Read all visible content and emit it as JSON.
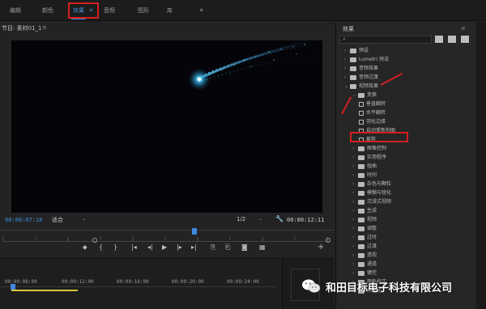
{
  "workspace_tabs": [
    "编辑",
    "颜色",
    "效果",
    "音频",
    "图形",
    "库",
    "»"
  ],
  "workspace_active": "效果",
  "workspace_menu_icon": "≡",
  "program_monitor": {
    "title": "节目: 素材01_1",
    "menu": "≡",
    "timecode_left": "00:00:07:18",
    "fit_label": "适合",
    "resolution_label": "1/2",
    "timecode_right": "00:00:12:11"
  },
  "transport_icons": [
    "marker-icon",
    "in-point-icon",
    "out-point-icon",
    "go-to-in-icon",
    "step-back-icon",
    "play-icon",
    "step-forward-icon",
    "go-to-out-icon",
    "insert-icon",
    "overwrite-icon",
    "export-frame-icon",
    "add-button-icon"
  ],
  "timeline": {
    "ticks": [
      "00:00:08:00",
      "00:00:12:00",
      "00:00:16:00",
      "00:00:20:00",
      "00:00:24:00"
    ]
  },
  "effects_panel": {
    "title": "效果",
    "menu": "≡",
    "tree": [
      {
        "label": "预设",
        "level": 0,
        "expanded": false,
        "type": "folder"
      },
      {
        "label": "Lumetri 预设",
        "level": 0,
        "expanded": false,
        "type": "folder"
      },
      {
        "label": "音频效果",
        "level": 0,
        "expanded": false,
        "type": "folder"
      },
      {
        "label": "音频过渡",
        "level": 0,
        "expanded": false,
        "type": "folder"
      },
      {
        "label": "视频效果",
        "level": 0,
        "expanded": true,
        "type": "folder"
      },
      {
        "label": "变换",
        "level": 1,
        "expanded": true,
        "type": "folder"
      },
      {
        "label": "垂直翻转",
        "level": 2,
        "type": "effect"
      },
      {
        "label": "水平翻转",
        "level": 2,
        "type": "effect"
      },
      {
        "label": "羽化边缘",
        "level": 2,
        "type": "effect"
      },
      {
        "label": "自动重新构图",
        "level": 2,
        "type": "effect"
      },
      {
        "label": "裁剪",
        "level": 2,
        "type": "effect"
      },
      {
        "label": "图像控制",
        "level": 1,
        "expanded": false,
        "type": "folder"
      },
      {
        "label": "实用程序",
        "level": 1,
        "expanded": false,
        "type": "folder"
      },
      {
        "label": "扭曲",
        "level": 1,
        "expanded": false,
        "type": "folder"
      },
      {
        "label": "时间",
        "level": 1,
        "expanded": false,
        "type": "folder"
      },
      {
        "label": "杂色与颗粒",
        "level": 1,
        "expanded": false,
        "type": "folder"
      },
      {
        "label": "模糊与锐化",
        "level": 1,
        "expanded": false,
        "type": "folder"
      },
      {
        "label": "沉浸式视频",
        "level": 1,
        "expanded": false,
        "type": "folder"
      },
      {
        "label": "生成",
        "level": 1,
        "expanded": false,
        "type": "folder"
      },
      {
        "label": "视频",
        "level": 1,
        "expanded": false,
        "type": "folder"
      },
      {
        "label": "调整",
        "level": 1,
        "expanded": false,
        "type": "folder"
      },
      {
        "label": "过时",
        "level": 1,
        "expanded": false,
        "type": "folder"
      },
      {
        "label": "过渡",
        "level": 1,
        "expanded": false,
        "type": "folder"
      },
      {
        "label": "透视",
        "level": 1,
        "expanded": false,
        "type": "folder"
      },
      {
        "label": "通道",
        "level": 1,
        "expanded": false,
        "type": "folder"
      },
      {
        "label": "键控",
        "level": 1,
        "expanded": false,
        "type": "folder"
      },
      {
        "label": "颜色校正",
        "level": 1,
        "expanded": false,
        "type": "folder"
      },
      {
        "label": "风格化",
        "level": 1,
        "expanded": false,
        "type": "folder"
      }
    ],
    "highlighted": "裁剪"
  },
  "watermark": {
    "text": "和田目标电子科技有限公司"
  },
  "colors": {
    "accent": "#3c8cde",
    "annotation_red": "#d42020",
    "playhead_yellow": "#d8c83a"
  }
}
